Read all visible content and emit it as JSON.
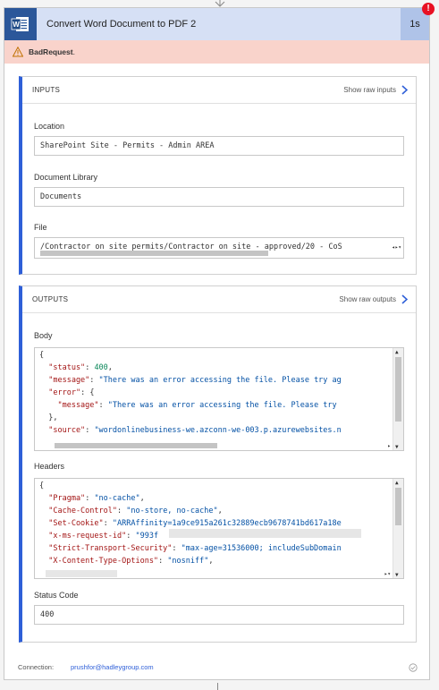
{
  "header": {
    "title": "Convert Word Document to PDF 2",
    "duration": "1s",
    "error_badge": "!"
  },
  "error": {
    "title": "BadRequest",
    "suffix": "."
  },
  "inputs": {
    "section_title": "INPUTS",
    "raw_link": "Show raw inputs",
    "fields": [
      {
        "label": "Location",
        "value": "SharePoint Site - Permits - Admin AREA"
      },
      {
        "label": "Document Library",
        "value": "Documents"
      },
      {
        "label": "File",
        "value": "/Contractor on site permits/Contractor on site - approved/20 - CoS"
      }
    ]
  },
  "outputs": {
    "section_title": "OUTPUTS",
    "raw_link": "Show raw outputs",
    "body_label": "Body",
    "body_lines": [
      {
        "k": "{",
        "v": ""
      },
      {
        "k": "  \"status\"",
        "sep": ": ",
        "v": "400",
        "t": "n",
        "end": ","
      },
      {
        "k": "  \"message\"",
        "sep": ": ",
        "v": "\"There was an error accessing the file. Please try ag",
        "t": "s",
        "end": ""
      },
      {
        "k": "  \"error\"",
        "sep": ": ",
        "v": "{",
        "t": "p",
        "end": ""
      },
      {
        "k": "    \"message\"",
        "sep": ": ",
        "v": "\"There was an error accessing the file. Please try",
        "t": "s",
        "end": ""
      },
      {
        "k": "  },",
        "v": ""
      },
      {
        "k": "  \"source\"",
        "sep": ": ",
        "v": "\"wordonlinebusiness-we.azconn-we-003.p.azurewebsites.n",
        "t": "s",
        "end": ""
      }
    ],
    "headers_label": "Headers",
    "header_lines": [
      {
        "k": "{",
        "v": ""
      },
      {
        "k": "  \"Pragma\"",
        "sep": ": ",
        "v": "\"no-cache\"",
        "t": "s",
        "end": ","
      },
      {
        "k": "  \"Cache-Control\"",
        "sep": ": ",
        "v": "\"no-store, no-cache\"",
        "t": "s",
        "end": ","
      },
      {
        "k": "  \"Set-Cookie\"",
        "sep": ": ",
        "v": "\"ARRAffinity=1a9ce915a261c32889ecb9678741bd617a18e",
        "t": "s",
        "end": ""
      },
      {
        "k": "  \"x-ms-request-id\"",
        "sep": ": ",
        "v": "\"993f",
        "t": "s",
        "end": ""
      },
      {
        "k": "  \"Strict-Transport-Security\"",
        "sep": ": ",
        "v": "\"max-age=31536000; includeSubDomain",
        "t": "s",
        "end": ""
      },
      {
        "k": "  \"X-Content-Type-Options\"",
        "sep": ": ",
        "v": "\"nosniff\"",
        "t": "s",
        "end": ","
      }
    ],
    "status_label": "Status Code",
    "status_value": "400"
  },
  "footer": {
    "connection_label": "Connection:",
    "connection_value": "prushfor@hadleygroup.com"
  },
  "colors": {
    "accent": "#2e5fd8",
    "word_blue": "#2b579a",
    "error_bg": "#f9d3cb",
    "header_bg": "#d6e0f5"
  }
}
